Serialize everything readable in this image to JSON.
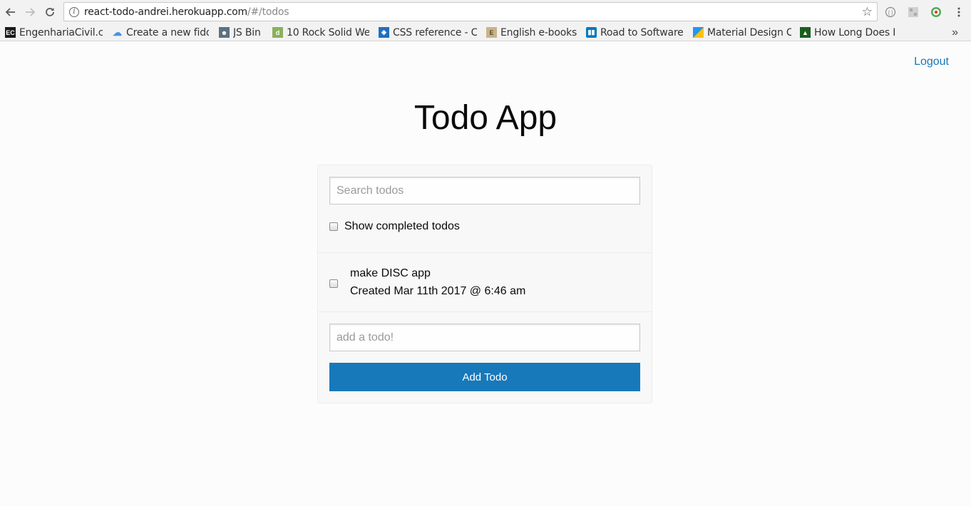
{
  "browser": {
    "url_host": "react-todo-andrei.herokuapp.com",
    "url_path": "/#/todos",
    "back_icon": "arrow-left-icon",
    "forward_icon": "arrow-right-icon",
    "reload_icon": "reload-icon",
    "bookmarks": [
      {
        "label": "EngenhariaCivil.c",
        "icon": "ec-icon",
        "color": "#1a1a1a"
      },
      {
        "label": "Create a new fidd",
        "icon": "cloud-icon",
        "color": "#4a90e2"
      },
      {
        "label": "JS Bin",
        "icon": "jsbin-icon",
        "color": "#5c7080"
      },
      {
        "label": "10 Rock Solid We",
        "icon": "d-icon",
        "color": "#8bb05a"
      },
      {
        "label": "CSS reference - C",
        "icon": "css-ref-icon",
        "color": "#2070c0"
      },
      {
        "label": "English e-books",
        "icon": "book-icon",
        "color": "#8a6d3b"
      },
      {
        "label": "Road to Software",
        "icon": "trello-icon",
        "color": "#0079bf"
      },
      {
        "label": "Material Design C",
        "icon": "material-icon",
        "color": "#2196f3"
      },
      {
        "label": "How Long Does I",
        "icon": "hl-icon",
        "color": "#1b5e20"
      }
    ]
  },
  "header": {
    "logout_label": "Logout",
    "title": "Todo App"
  },
  "search": {
    "placeholder": "Search todos",
    "value": "",
    "show_completed_label": "Show completed todos",
    "show_completed_checked": false
  },
  "todos": [
    {
      "text": "make DISC app",
      "created": "Created Mar 11th 2017 @ 6:46 am",
      "completed": false
    }
  ],
  "add": {
    "placeholder": "add a todo!",
    "button_label": "Add Todo"
  },
  "colors": {
    "accent": "#1779ba"
  }
}
